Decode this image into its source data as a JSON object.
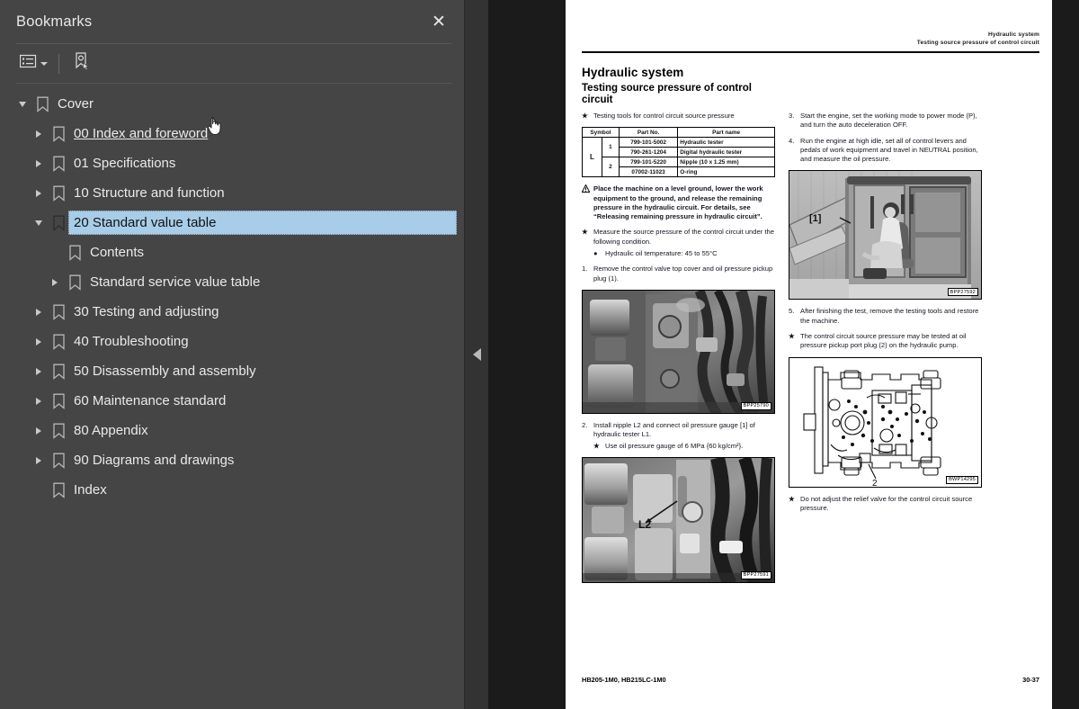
{
  "panel": {
    "title": "Bookmarks",
    "close_label": "✕",
    "toolbar": {
      "options_icon": "list-options-icon",
      "new_bookmark_icon": "new-bookmark-icon"
    }
  },
  "tree": [
    {
      "label": "Cover",
      "depth": 0,
      "state": "expanded",
      "selected": false,
      "hovered": false
    },
    {
      "label": "00 Index and foreword",
      "depth": 1,
      "state": "collapsed",
      "selected": false,
      "hovered": true
    },
    {
      "label": "01 Specifications",
      "depth": 1,
      "state": "collapsed",
      "selected": false,
      "hovered": false
    },
    {
      "label": "10 Structure and function",
      "depth": 1,
      "state": "collapsed",
      "selected": false,
      "hovered": false
    },
    {
      "label": "20 Standard value table",
      "depth": 1,
      "state": "expanded",
      "selected": true,
      "hovered": false
    },
    {
      "label": "Contents",
      "depth": 2,
      "state": "leaf",
      "selected": false,
      "hovered": false
    },
    {
      "label": "Standard service value table",
      "depth": 2,
      "state": "collapsed",
      "selected": false,
      "hovered": false
    },
    {
      "label": "30 Testing and adjusting",
      "depth": 1,
      "state": "collapsed",
      "selected": false,
      "hovered": false
    },
    {
      "label": "40 Troubleshooting",
      "depth": 1,
      "state": "collapsed",
      "selected": false,
      "hovered": false
    },
    {
      "label": "50 Disassembly and assembly",
      "depth": 1,
      "state": "collapsed",
      "selected": false,
      "hovered": false
    },
    {
      "label": "60 Maintenance standard",
      "depth": 1,
      "state": "collapsed",
      "selected": false,
      "hovered": false
    },
    {
      "label": "80 Appendix",
      "depth": 1,
      "state": "collapsed",
      "selected": false,
      "hovered": false
    },
    {
      "label": "90 Diagrams and drawings",
      "depth": 1,
      "state": "collapsed",
      "selected": false,
      "hovered": false
    },
    {
      "label": "Index",
      "depth": 1,
      "state": "leaf",
      "selected": false,
      "hovered": false
    }
  ],
  "splitter": {
    "collapse_icon": "collapse-left-arrow-icon"
  },
  "document": {
    "header_line1": "Hydraulic system",
    "header_line2": "Testing source pressure of control circuit",
    "title": "Hydraulic system",
    "subtitle": "Testing source pressure of control circuit",
    "tools_caption": "Testing tools for control circuit source pressure",
    "table": {
      "headers": [
        "Symbol",
        "Part No.",
        "Part name"
      ],
      "symbol": "L",
      "rows": [
        {
          "group": "1",
          "part_no": "799-101-5002",
          "part_name": "Hydraulic tester"
        },
        {
          "group": "1",
          "part_no": "790-261-1204",
          "part_name": "Digital hydraulic tester"
        },
        {
          "group": "2",
          "part_no": "799-101-5220",
          "part_name": "Nipple (10 x 1.25 mm)"
        },
        {
          "group": "2",
          "part_no": "07002-11023",
          "part_name": "O-ring"
        }
      ]
    },
    "warning": "Place the machine on a level ground, lower the work equipment to the ground, and release the remaining pressure in the hydraulic circuit. For details, see “Releasing remaining pressure in hydraulic circuit”.",
    "note_measure": "Measure the source pressure of the control circuit under the following condition.",
    "bullet_temp": "Hydraulic oil temperature: 45 to 55°C",
    "step1_num": "1.",
    "step1": "Remove the control valve top cover and oil pressure pickup plug (1).",
    "step2_num": "2.",
    "step2": "Install nipple L2 and connect oil pressure gauge [1] of hydraulic tester L1.",
    "step2_note": "Use oil pressure gauge of 6 MPa {60 kg/cm²}.",
    "step3_num": "3.",
    "step3": "Start the engine, set the working mode to power mode (P), and turn the auto deceleration OFF.",
    "step4_num": "4.",
    "step4": "Run the engine at high idle, set all of control levers and pedals of work equipment and travel in NEUTRAL position, and measure the oil pressure.",
    "step5_num": "5.",
    "step5": "After finishing the test, remove the testing tools and restore the machine.",
    "note_pickup": "The control circuit source pressure may be tested at oil pressure pickup port plug (2) on the hydraulic pump.",
    "note_relief": "Do not adjust the relief valve for the control circuit source pressure.",
    "figures": {
      "valve_photo": {
        "caption": "BPP25790",
        "alt": "control-valve-photo"
      },
      "nipple_photo": {
        "caption": "BPP27591",
        "alt": "nipple-l2-photo",
        "callout": "L2"
      },
      "cab_photo": {
        "caption": "BPP27592",
        "alt": "operator-cab-photo",
        "callout": "[1]"
      },
      "pump_drawing": {
        "caption": "BWP14295",
        "alt": "hydraulic-pump-drawing",
        "callout": "2"
      }
    },
    "footer_left": "HB205-1M0, HB215LC-1M0",
    "footer_right": "30-37"
  },
  "colors": {
    "panel_bg": "#454545",
    "selection": "#a8cde8",
    "viewer_bg": "#1b1b1b",
    "splitter_bg": "#333333",
    "page_bg": "#ffffff"
  }
}
